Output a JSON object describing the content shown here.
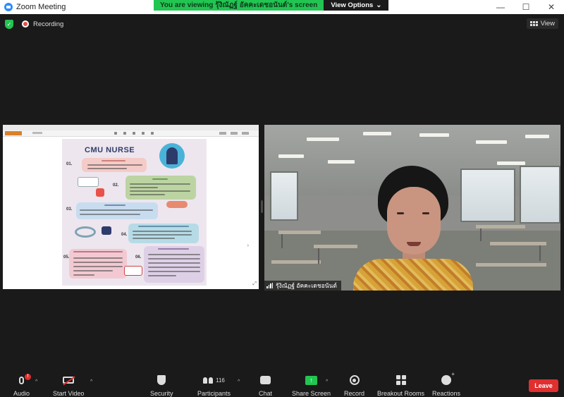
{
  "window": {
    "title": "Zoom Meeting",
    "viewing_banner": "You are viewing รุ้งิณัฏฐ์ อัคคะเดชอนันต์'s screen",
    "view_options": "View Options",
    "controls": [
      "—",
      "☐",
      "✕"
    ]
  },
  "header": {
    "recording_label": "Recording",
    "view_label": "View"
  },
  "poster": {
    "title": "CMU NURSE",
    "numbers": [
      "01.",
      "02.",
      "03.",
      "04.",
      "05.",
      "06."
    ]
  },
  "participant": {
    "name": "รุ้งิณัฏฐ์ อัคคะเดชอนันต์"
  },
  "toolbar": {
    "audio": "Audio",
    "audio_badge": "!",
    "start_video": "Start Video",
    "security": "Security",
    "participants": "Participants",
    "participants_count": "116",
    "chat": "Chat",
    "share_screen": "Share Screen",
    "record": "Record",
    "breakout_rooms": "Breakout Rooms",
    "reactions": "Reactions",
    "leave": "Leave"
  },
  "colors": {
    "accent_green": "#23c552",
    "leave_red": "#e02f2f",
    "zoom_blue": "#2d8cff"
  }
}
